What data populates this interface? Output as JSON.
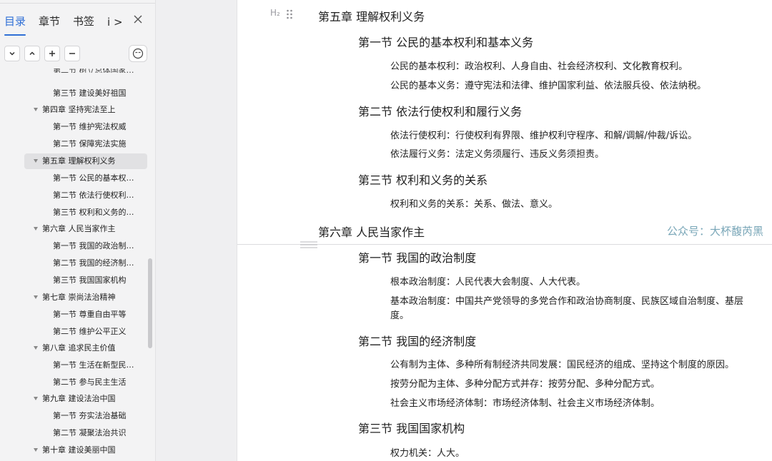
{
  "sidebar": {
    "tabs": [
      "目录",
      "章节",
      "书签"
    ],
    "more_tab": "i >",
    "toc": [
      {
        "level": "section",
        "text": "第二节 树立总体国家…",
        "clipped": true
      },
      {
        "level": "section",
        "text": "第三节 建设美好祖国"
      },
      {
        "level": "chapter",
        "text": "第四章 坚持宪法至上"
      },
      {
        "level": "section",
        "text": "第一节 维护宪法权威"
      },
      {
        "level": "section",
        "text": "第二节 保障宪法实施"
      },
      {
        "level": "chapter",
        "text": "第五章 理解权利义务",
        "active": true
      },
      {
        "level": "section",
        "text": "第一节 公民的基本权…"
      },
      {
        "level": "section",
        "text": "第二节 依法行使权利…"
      },
      {
        "level": "section",
        "text": "第三节 权利和义务的…"
      },
      {
        "level": "chapter",
        "text": "第六章 人民当家作主"
      },
      {
        "level": "section",
        "text": "第一节 我国的政治制…"
      },
      {
        "level": "section",
        "text": "第二节 我国的经济制…"
      },
      {
        "level": "section",
        "text": "第三节 我国国家机构"
      },
      {
        "level": "chapter",
        "text": "第七章 崇尚法治精神"
      },
      {
        "level": "section",
        "text": "第一节 尊重自由平等"
      },
      {
        "level": "section",
        "text": "第二节 维护公平正义"
      },
      {
        "level": "chapter",
        "text": "第八章 追求民主价值"
      },
      {
        "level": "section",
        "text": "第一节 生活在新型民…"
      },
      {
        "level": "section",
        "text": "第二节 参与民主生活"
      },
      {
        "level": "chapter",
        "text": "第九章 建设法治中国"
      },
      {
        "level": "section",
        "text": "第一节 夯实法治基础"
      },
      {
        "level": "section",
        "text": "第二节 凝聚法治共识"
      },
      {
        "level": "chapter",
        "text": "第十章 建设美丽中国"
      }
    ]
  },
  "document": {
    "heading_hint": "H₂",
    "lines": [
      {
        "kind": "h1",
        "text": "第五章  理解权利义务"
      },
      {
        "kind": "h2",
        "text": "第一节  公民的基本权利和基本义务"
      },
      {
        "kind": "p",
        "text": "公民的基本权利：政治权利、人身自由、社会经济权利、文化教育权利。"
      },
      {
        "kind": "p",
        "text": "公民的基本义务：遵守宪法和法律、维护国家利益、依法服兵役、依法纳税。"
      },
      {
        "kind": "h2",
        "text": "第二节  依法行使权利和履行义务"
      },
      {
        "kind": "p",
        "text": "依法行使权利：行使权利有界限、维护权利守程序、和解/调解/仲裁/诉讼。"
      },
      {
        "kind": "p",
        "text": "依法履行义务：法定义务须履行、违反义务须担责。"
      },
      {
        "kind": "h2",
        "text": "第三节  权利和义务的关系"
      },
      {
        "kind": "p",
        "text": "权利和义务的关系：关系、做法、意义。"
      },
      {
        "kind": "h1",
        "text": "第六章  人民当家作主"
      },
      {
        "kind": "h2",
        "text": "第一节  我国的政治制度"
      },
      {
        "kind": "p",
        "text": "根本政治制度：人民代表大会制度、人大代表。"
      },
      {
        "kind": "p",
        "text": "基本政治制度：中国共产党领导的多党合作和政治协商制度、民族区域自治制度、基层"
      },
      {
        "kind": "p",
        "text": "度。"
      },
      {
        "kind": "h2",
        "text": "第二节  我国的经济制度"
      },
      {
        "kind": "p",
        "text": "公有制为主体、多种所有制经济共同发展：国民经济的组成、坚持这个制度的原因。"
      },
      {
        "kind": "p",
        "text": "按劳分配为主体、多种分配方式并存：按劳分配、多种分配方式。"
      },
      {
        "kind": "p",
        "text": "社会主义市场经济体制：市场经济体制、社会主义市场经济体制。"
      },
      {
        "kind": "h2",
        "text": "第三节  我国国家机构"
      },
      {
        "kind": "p",
        "text": "权力机关：人大。"
      }
    ],
    "watermark": "公众号：大杯馥芮黑"
  }
}
